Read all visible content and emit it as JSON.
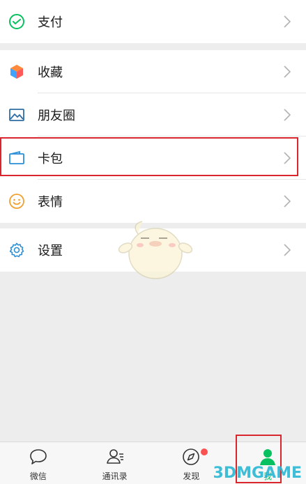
{
  "menu_groups": [
    [
      {
        "label": "支付",
        "icon": "payment-icon"
      }
    ],
    [
      {
        "label": "收藏",
        "icon": "favorites-icon"
      },
      {
        "label": "朋友圈",
        "icon": "moments-icon"
      },
      {
        "label": "卡包",
        "icon": "card-wallet-icon"
      },
      {
        "label": "表情",
        "icon": "sticker-icon"
      }
    ],
    [
      {
        "label": "设置",
        "icon": "settings-icon"
      }
    ]
  ],
  "tabbar": {
    "items": [
      {
        "label": "微信",
        "icon": "chat-icon"
      },
      {
        "label": "通讯录",
        "icon": "contacts-icon"
      },
      {
        "label": "发现",
        "icon": "discover-icon"
      },
      {
        "label": "我",
        "icon": "me-icon"
      }
    ]
  },
  "watermark": {
    "text": "3DMGAME"
  },
  "colors": {
    "accent": "#07c160",
    "highlight": "#d9262c",
    "watermark": "#2bb7d4"
  }
}
